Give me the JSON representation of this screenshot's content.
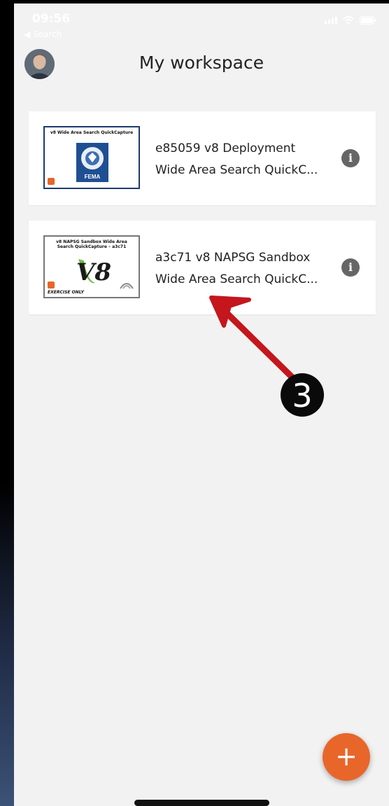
{
  "status_bar": {
    "time": "09:56",
    "back_label": "◀ Search"
  },
  "header": {
    "title": "My workspace"
  },
  "projects": [
    {
      "line1": "e85059 v8 Deployment",
      "line2": "Wide Area Search QuickC...",
      "thumbnail_title": "v8 Wide Area Search QuickCapture",
      "thumbnail_seal_text": "FEMA"
    },
    {
      "line1": "a3c71 v8 NAPSG Sandbox",
      "line2": "Wide Area Search QuickC...",
      "thumbnail_title": "v8 NAPSG Sandbox Wide Area Search QuickCapture – a3c71",
      "thumbnail_logo_text": "V8",
      "thumbnail_tag": "EXERCISE ONLY"
    }
  ],
  "annotation": {
    "number": "3"
  },
  "fab": {
    "label": "+"
  },
  "colors": {
    "accent": "#e8662a",
    "annotation_arrow": "#c4161c",
    "background": "#f2f2f2"
  }
}
